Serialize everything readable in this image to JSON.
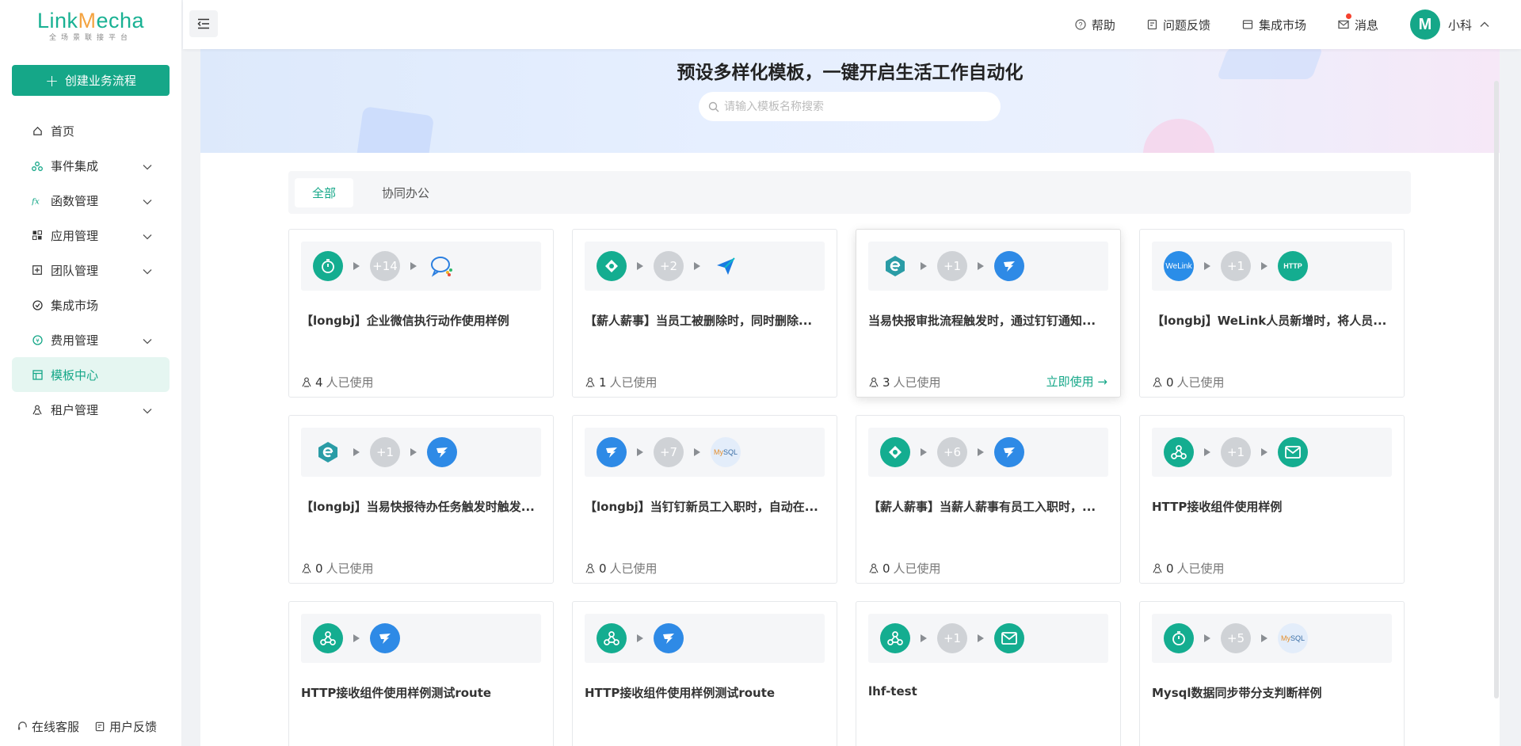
{
  "brand": {
    "name_a": "Link",
    "name_m": "M",
    "name_b": "echa",
    "tagline": "全场景联接平台",
    "color": "#15a788"
  },
  "sidebar": {
    "create_label": "创建业务流程",
    "items": [
      {
        "label": "首页",
        "icon": "home-icon",
        "expandable": false
      },
      {
        "label": "事件集成",
        "icon": "event-icon",
        "expandable": true
      },
      {
        "label": "函数管理",
        "icon": "function-icon",
        "expandable": true
      },
      {
        "label": "应用管理",
        "icon": "app-icon",
        "expandable": true
      },
      {
        "label": "团队管理",
        "icon": "team-icon",
        "expandable": true
      },
      {
        "label": "集成市场",
        "icon": "market-icon",
        "expandable": false
      },
      {
        "label": "费用管理",
        "icon": "fee-icon",
        "expandable": true
      },
      {
        "label": "模板中心",
        "icon": "template-icon",
        "expandable": false,
        "active": true
      },
      {
        "label": "租户管理",
        "icon": "tenant-icon",
        "expandable": true
      }
    ],
    "bottom": {
      "service": "在线客服",
      "feedback": "用户反馈"
    }
  },
  "header": {
    "help": "帮助",
    "issue": "问题反馈",
    "market": "集成市场",
    "messages": "消息",
    "user_name": "小科"
  },
  "banner": {
    "title": "预设多样化模板，一键开启生活工作自动化",
    "search_placeholder": "请输入模板名称搜索"
  },
  "tabs": [
    {
      "label": "全部",
      "active": true
    },
    {
      "label": "协同办公",
      "active": false
    }
  ],
  "use_now_label": "立即使用",
  "usage_suffix": "人已使用",
  "cards": [
    {
      "title": "【longbj】企业微信执行动作使用样例",
      "count": "4",
      "start": "timer",
      "mid": "+14",
      "end": "wecom"
    },
    {
      "title": "【薪人薪事】当员工被删除时，同时删除...",
      "count": "1",
      "start": "xinren",
      "mid": "+2",
      "end": "paperplane"
    },
    {
      "title": "当易快报审批流程触发时，通过钉钉通知...",
      "count": "3",
      "start": "ekuaibao",
      "mid": "+1",
      "end": "dingtalk",
      "hover": true
    },
    {
      "title": "【longbj】WeLink人员新增时，将人员...",
      "count": "0",
      "start": "welink",
      "mid": "+1",
      "end": "http"
    },
    {
      "title": "【longbj】当易快报待办任务触发时触发...",
      "count": "0",
      "start": "ekuaibao",
      "mid": "+1",
      "end": "dingtalk"
    },
    {
      "title": "【longbj】当钉钉新员工入职时，自动在...",
      "count": "0",
      "start": "dingtalk",
      "mid": "+7",
      "end": "mysql"
    },
    {
      "title": "【薪人薪事】当薪人薪事有员工入职时，...",
      "count": "0",
      "start": "xinren",
      "mid": "+6",
      "end": "dingtalk"
    },
    {
      "title": "HTTP接收组件使用样例",
      "count": "0",
      "start": "webhook",
      "mid": "+1",
      "end": "mail"
    },
    {
      "title": "HTTP接收组件使用样例测试route",
      "count": "",
      "start": "webhook",
      "mid": "",
      "end": "dingtalk"
    },
    {
      "title": "HTTP接收组件使用样例测试route",
      "count": "",
      "start": "webhook",
      "mid": "",
      "end": "dingtalk"
    },
    {
      "title": "lhf-test",
      "count": "",
      "start": "webhook",
      "mid": "+1",
      "end": "mail"
    },
    {
      "title": "Mysql数据同步带分支判断样例",
      "count": "",
      "start": "timer",
      "mid": "+5",
      "end": "mysql"
    }
  ]
}
